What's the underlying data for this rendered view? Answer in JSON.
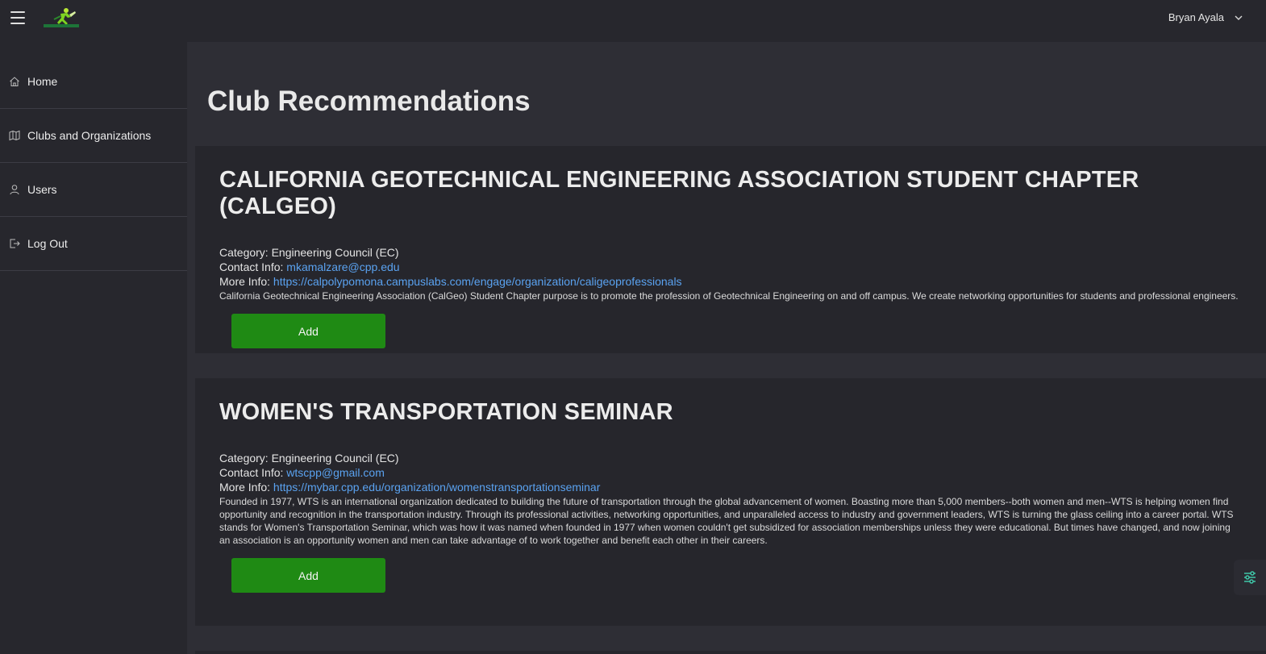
{
  "header": {
    "logo_alt": "BRONCODASH",
    "user_name": "Bryan Ayala"
  },
  "sidebar": {
    "items": [
      {
        "label": "Home",
        "icon": "home-icon"
      },
      {
        "label": "Clubs and Organizations",
        "icon": "map-icon"
      },
      {
        "label": "Users",
        "icon": "user-icon"
      },
      {
        "label": "Log Out",
        "icon": "logout-icon"
      }
    ]
  },
  "main": {
    "title": "Club Recommendations",
    "category_prefix": "Category:",
    "contact_prefix": "Contact Info:",
    "more_prefix": "More Info:",
    "add_label": "Add",
    "clubs": [
      {
        "name": "CALIFORNIA GEOTECHNICAL ENGINEERING ASSOCIATION STUDENT CHAPTER (CALGEO)",
        "category": "Engineering Council (EC)",
        "contact": "mkamalzare@cpp.edu",
        "more_info": "https://calpolypomona.campuslabs.com/engage/organization/caligeoprofessionals",
        "description": "California Geotechnical Engineering Association (CalGeo) Student Chapter purpose is to promote the profession of Geotechnical Engineering on and off campus. We create networking opportunities for students and professional engineers."
      },
      {
        "name": "WOMEN'S TRANSPORTATION SEMINAR",
        "category": "Engineering Council (EC)",
        "contact": "wtscpp@gmail.com",
        "more_info": "https://mybar.cpp.edu/organization/womenstransportationseminar",
        "description": "Founded in 1977, WTS is an international organization dedicated to building the future of transportation through the global advancement of women. Boasting more than 5,000 members--both women and men--WTS is helping women find opportunity and recognition in the transportation industry. Through its professional activities, networking opportunities, and unparalleled access to industry and government leaders, WTS is turning the glass ceiling into a career portal. WTS stands for Women's Transportation Seminar, which was how it was named when founded in 1977 when women couldn't get subsidized for association memberships unless they were educational. But times have changed, and now joining an association is an opportunity women and men can take advantage of to work together and benefit each other in their careers."
      }
    ]
  },
  "colors": {
    "accent_button": "#1f8a14",
    "link": "#5aa2f0",
    "settings_icon": "#3fc6a8"
  }
}
